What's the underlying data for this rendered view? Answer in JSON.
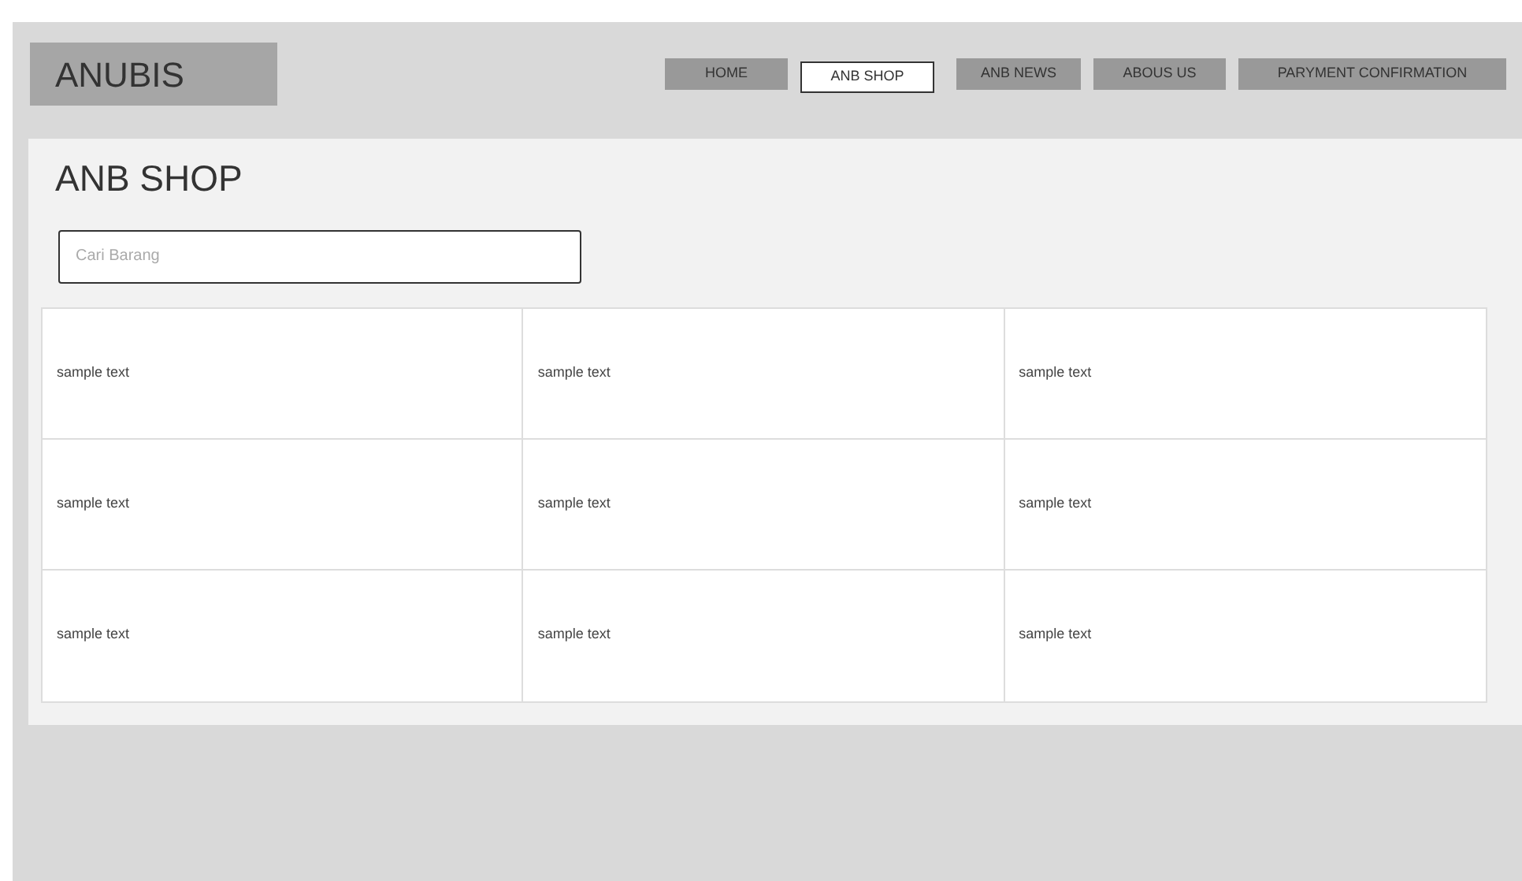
{
  "logo": "ANUBIS",
  "nav": [
    {
      "label": "HOME",
      "selected": false
    },
    {
      "label": "ANB SHOP",
      "selected": true
    },
    {
      "label": "ANB NEWS",
      "selected": false
    },
    {
      "label": "ABOUS US",
      "selected": false
    },
    {
      "label": "PARYMENT CONFIRMATION",
      "selected": false
    }
  ],
  "page_title": "ANB SHOP",
  "search": {
    "placeholder": "Cari Barang"
  },
  "grid": [
    [
      "sample text",
      "sample text",
      "sample text"
    ],
    [
      "sample text",
      "sample text",
      "sample text"
    ],
    [
      "sample text",
      "sample text",
      "sample text"
    ]
  ]
}
